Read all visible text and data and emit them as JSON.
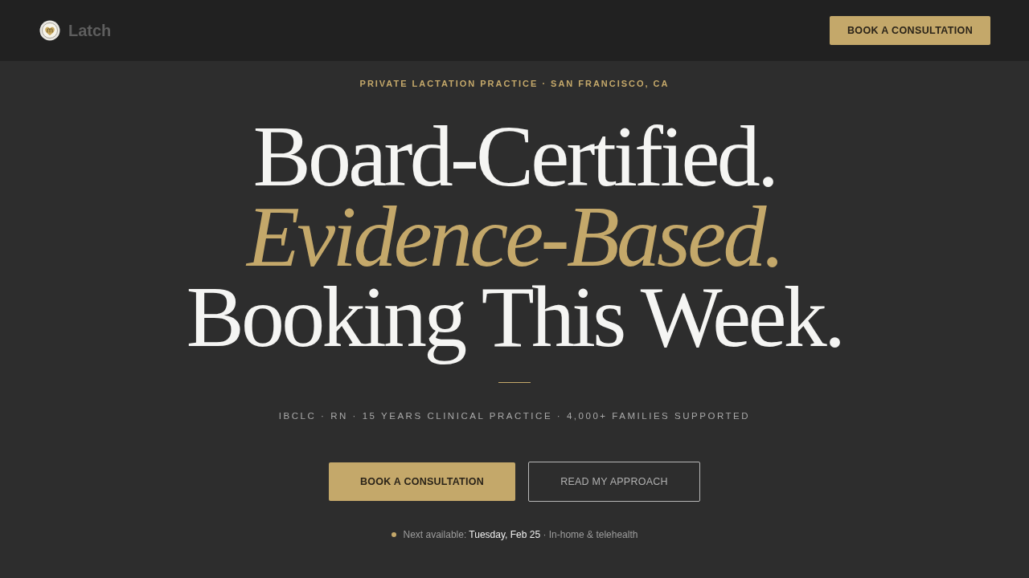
{
  "header": {
    "brand": "Latch",
    "cta": "BOOK A CONSULTATION"
  },
  "hero": {
    "eyebrow": "PRIVATE LACTATION PRACTICE · SAN FRANCISCO, CA",
    "headline": [
      {
        "text": "Board-Certified.",
        "kind": "plain"
      },
      {
        "text": "Evidence-Based.",
        "kind": "accent"
      },
      {
        "text": "Booking This Week.",
        "kind": "plain"
      }
    ],
    "credentials": "IBCLC · RN · 15 YEARS CLINICAL PRACTICE · 4,000+ FAMILIES SUPPORTED",
    "buttons": [
      {
        "label": "BOOK A CONSULTATION",
        "kind": "primary"
      },
      {
        "label": "READ MY APPROACH",
        "kind": "outline"
      }
    ],
    "availability": "Next available: **Tuesday, Feb 25** · In-home & telehealth"
  }
}
